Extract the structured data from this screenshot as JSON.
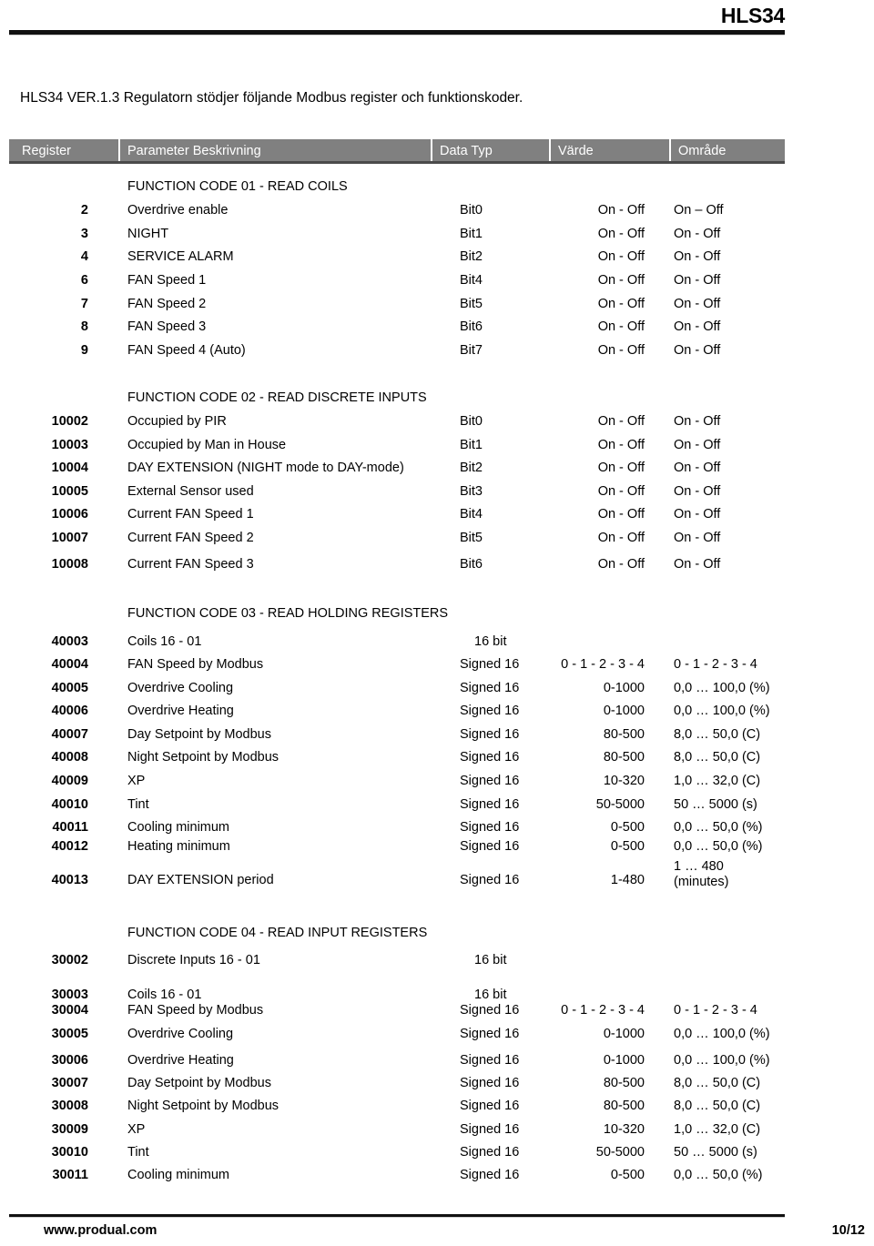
{
  "header": {
    "title": "HLS34"
  },
  "intro": {
    "text": "HLS34 VER.1.3 Regulatorn stödjer följande Modbus register och funktionskoder."
  },
  "table": {
    "columns": [
      {
        "label": "Register"
      },
      {
        "label": "Parameter Beskrivning"
      },
      {
        "label": "Data Typ"
      },
      {
        "label": "Värde"
      },
      {
        "label": "Område"
      }
    ],
    "sections": [
      {
        "title": "FUNCTION CODE 01 - READ COILS",
        "rows": [
          {
            "register": "2",
            "description": "Overdrive enable",
            "type": "Bit0",
            "value": "On - Off",
            "range": "On – Off"
          },
          {
            "register": "3",
            "description": "NIGHT",
            "type": "Bit1",
            "value": "On - Off",
            "range": "On - Off"
          },
          {
            "register": "4",
            "description": "SERVICE ALARM",
            "type": "Bit2",
            "value": "On - Off",
            "range": "On - Off"
          },
          {
            "register": "6",
            "description": "FAN Speed 1",
            "type": "Bit4",
            "value": "On - Off",
            "range": "On - Off"
          },
          {
            "register": "7",
            "description": "FAN Speed 2",
            "type": "Bit5",
            "value": "On - Off",
            "range": "On - Off"
          },
          {
            "register": "8",
            "description": "FAN Speed 3",
            "type": "Bit6",
            "value": "On - Off",
            "range": "On - Off"
          },
          {
            "register": "9",
            "description": "FAN Speed 4 (Auto)",
            "type": "Bit7",
            "value": "On - Off",
            "range": "On - Off"
          }
        ]
      },
      {
        "title": "FUNCTION CODE 02 - READ DISCRETE INPUTS",
        "rows": [
          {
            "register": "10002",
            "description": "Occupied by PIR",
            "type": "Bit0",
            "value": "On - Off",
            "range": "On - Off"
          },
          {
            "register": "10003",
            "description": "Occupied by Man in House",
            "type": "Bit1",
            "value": "On - Off",
            "range": "On - Off"
          },
          {
            "register": "10004",
            "description": "DAY EXTENSION (NIGHT mode to DAY-mode)",
            "type": "Bit2",
            "value": "On - Off",
            "range": "On - Off"
          },
          {
            "register": "10005",
            "description": "External Sensor used",
            "type": "Bit3",
            "value": "On - Off",
            "range": "On - Off"
          },
          {
            "register": "10006",
            "description": "Current FAN Speed 1",
            "type": "Bit4",
            "value": "On - Off",
            "range": "On - Off"
          },
          {
            "register": "10007",
            "description": "Current FAN Speed 2",
            "type": "Bit5",
            "value": "On - Off",
            "range": "On - Off"
          },
          {
            "register": "10008",
            "description": "Current FAN Speed 3",
            "type": "Bit6",
            "value": "On - Off",
            "range": "On - Off"
          }
        ]
      },
      {
        "title": "FUNCTION CODE 03 - READ HOLDING REGISTERS",
        "rows": [
          {
            "register": "40003",
            "description": "Coils 16 - 01",
            "type": "16 bit",
            "value": "",
            "range": ""
          },
          {
            "register": "40004",
            "description": "FAN Speed by Modbus",
            "type": "Signed 16",
            "value": "0 - 1 - 2 - 3 - 4",
            "range": "0 - 1 - 2 - 3 - 4"
          },
          {
            "register": "40005",
            "description": "Overdrive Cooling",
            "type": "Signed 16",
            "value": "0-1000",
            "range": "0,0 … 100,0 (%)"
          },
          {
            "register": "40006",
            "description": "Overdrive Heating",
            "type": "Signed 16",
            "value": "0-1000",
            "range": "0,0 … 100,0 (%)"
          },
          {
            "register": "40007",
            "description": "Day Setpoint by Modbus",
            "type": "Signed 16",
            "value": "80-500",
            "range": "8,0 … 50,0 (C)"
          },
          {
            "register": "40008",
            "description": "Night Setpoint by Modbus",
            "type": "Signed 16",
            "value": "80-500",
            "range": "8,0 … 50,0 (C)"
          },
          {
            "register": "40009",
            "description": "XP",
            "type": "Signed 16",
            "value": "10-320",
            "range": "1,0 … 32,0 (C)"
          },
          {
            "register": "40010",
            "description": "Tint",
            "type": "Signed 16",
            "value": "50-5000",
            "range": "50 … 5000 (s)"
          },
          {
            "register": "40011",
            "description": "Cooling minimum",
            "type": "Signed 16",
            "value": "0-500",
            "range": "0,0 … 50,0 (%)"
          },
          {
            "register": "40012",
            "description": "Heating minimum",
            "type": "Signed 16",
            "value": "0-500",
            "range": "0,0 … 50,0 (%)"
          },
          {
            "register": "40013",
            "description": "DAY EXTENSION period",
            "type": "Signed 16",
            "value": "1-480",
            "range": "1 … 480\n(minutes)"
          }
        ]
      },
      {
        "title": "FUNCTION CODE 04 - READ INPUT REGISTERS",
        "rows": [
          {
            "register": "30002",
            "description": "Discrete Inputs 16 - 01",
            "type": "16 bit",
            "value": "",
            "range": ""
          },
          {
            "register": "30003",
            "description": "Coils 16 - 01",
            "type": "16 bit",
            "value": "",
            "range": ""
          },
          {
            "register": "30004",
            "description": "FAN Speed by Modbus",
            "type": "Signed 16",
            "value": "0 - 1 - 2 - 3 - 4",
            "range": "0 - 1 - 2 - 3 - 4"
          },
          {
            "register": "30005",
            "description": "Overdrive Cooling",
            "type": "Signed 16",
            "value": "0-1000",
            "range": "0,0 … 100,0 (%)"
          },
          {
            "register": "30006",
            "description": "Overdrive Heating",
            "type": "Signed 16",
            "value": "0-1000",
            "range": "0,0 … 100,0 (%)"
          },
          {
            "register": "30007",
            "description": "Day Setpoint by Modbus",
            "type": "Signed 16",
            "value": "80-500",
            "range": "8,0 … 50,0 (C)"
          },
          {
            "register": "30008",
            "description": "Night Setpoint by Modbus",
            "type": "Signed 16",
            "value": "80-500",
            "range": "8,0 … 50,0 (C)"
          },
          {
            "register": "30009",
            "description": "XP",
            "type": "Signed 16",
            "value": "10-320",
            "range": "1,0 … 32,0 (C)"
          },
          {
            "register": "30010",
            "description": "Tint",
            "type": "Signed 16",
            "value": "50-5000",
            "range": "50 … 5000 (s)"
          },
          {
            "register": "30011",
            "description": "Cooling minimum",
            "type": "Signed 16",
            "value": "0-500",
            "range": "0,0 … 50,0 (%)"
          }
        ]
      }
    ]
  },
  "footer": {
    "website": "www.produal.com",
    "page": "10/12"
  }
}
